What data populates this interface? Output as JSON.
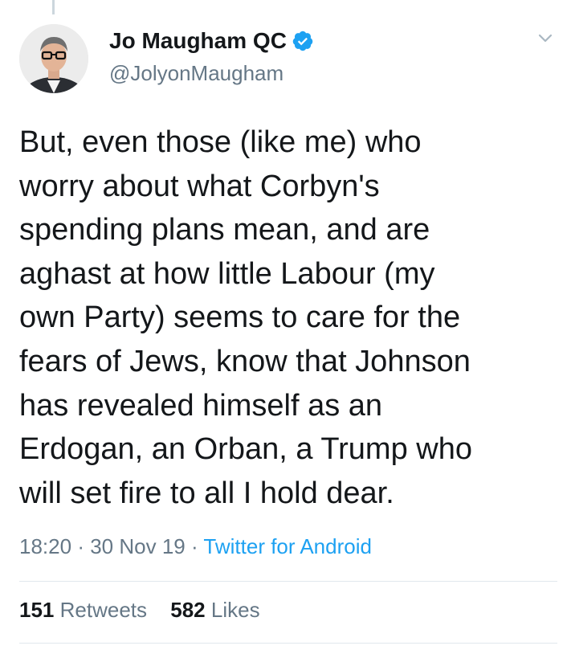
{
  "tweet": {
    "author": {
      "display_name": "Jo Maugham QC",
      "handle": "@JolyonMaugham",
      "verified": true
    },
    "text": "But, even those (like me) who\nworry about what Corbyn's\nspending plans mean, and are\naghast at how little Labour (my\nown Party) seems to care for the\nfears of Jews, know that Johnson\nhas revealed himself as an\nErdogan, an Orban, a Trump who\nwill set fire to all I hold dear.",
    "time": "18:20",
    "date": "30 Nov 19",
    "separator": "·",
    "source": "Twitter for Android",
    "retweets": {
      "count": "151",
      "label": "Retweets"
    },
    "likes": {
      "count": "582",
      "label": "Likes"
    }
  },
  "colors": {
    "text_primary": "#14171a",
    "text_secondary": "#657786",
    "link_blue": "#1da1f2",
    "divider": "#e1e8ed"
  },
  "icons": {
    "verified": "verified-badge-icon",
    "menu": "chevron-down-icon"
  }
}
